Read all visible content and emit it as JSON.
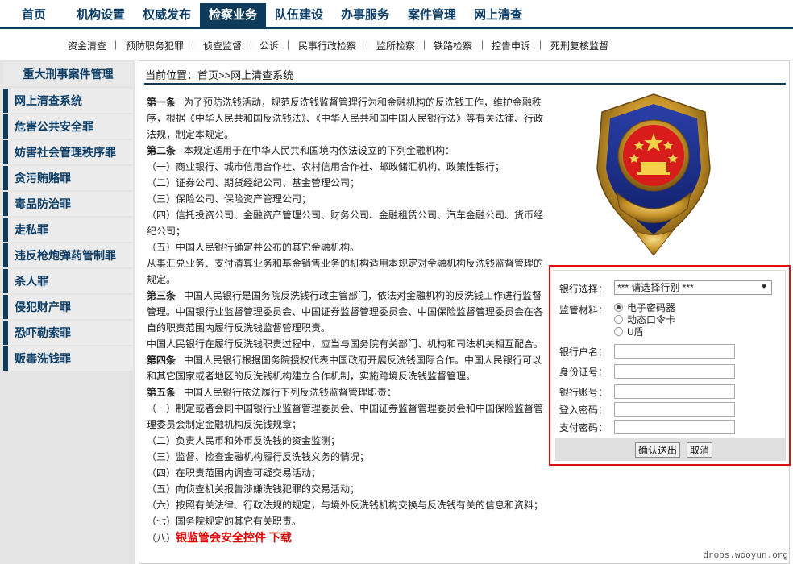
{
  "nav": {
    "items": [
      "首页",
      "机构设置",
      "权威发布",
      "检察业务",
      "队伍建设",
      "办事服务",
      "案件管理",
      "网上清查"
    ],
    "active_index": 3
  },
  "subnav": {
    "items": [
      "资金清查",
      "预防职务犯罪",
      "侦查监督",
      "公诉",
      "民事行政检察",
      "监所检察",
      "铁路检察",
      "控告申诉",
      "死刑复核监督"
    ]
  },
  "sidebar": {
    "title": "重大刑事案件管理",
    "items": [
      "网上清查系统",
      "危害公共安全罪",
      "妨害社会管理秩序罪",
      "贪污贿赂罪",
      "毒品防治罪",
      "走私罪",
      "违反枪炮弹药管制罪",
      "杀人罪",
      "侵犯财产罪",
      "恐吓勒索罪",
      "贩毒洗钱罪"
    ]
  },
  "breadcrumb": "当前位置：首页>>网上清查系统",
  "article": {
    "p1_head": "第一条",
    "p1": "为了预防洗钱活动，规范反洗钱监督管理行为和金融机构的反洗钱工作，维护金融秩序，根据《中华人民共和国反洗钱法》、《中华人民共和国中国人民银行法》等有关法律、行政法规，制定本规定。",
    "p2_head": "第二条",
    "p2": "本规定适用于在中华人民共和国境内依法设立的下列金融机构：",
    "p2_items": [
      "（一）商业银行、城市信用合作社、农村信用合作社、邮政储汇机构、政策性银行；",
      "（二）证券公司、期货经纪公司、基金管理公司；",
      "（三）保险公司、保险资产管理公司；",
      "（四）信托投资公司、金融资产管理公司、财务公司、金融租赁公司、汽车金融公司、货币经纪公司；",
      "（五）中国人民银行确定并公布的其它金融机构。"
    ],
    "p2_tail": "从事汇兑业务、支付清算业务和基金销售业务的机构适用本规定对金融机构反洗钱监督管理的规定。",
    "p3_head": "第三条",
    "p3": "中国人民银行是国务院反洗钱行政主管部门，依法对金融机构的反洗钱工作进行监督管理。中国银行业监督管理委员会、中国证券监督管理委员会、中国保险监督管理委员会在各自的职责范围内履行反洗钱监督管理职责。",
    "p3_tail": "中国人民银行在履行反洗钱职责过程中，应当与国务院有关部门、机构和司法机关相互配合。",
    "p4_head": "第四条",
    "p4": "中国人民银行根据国务院授权代表中国政府开展反洗钱国际合作。中国人民银行可以和其它国家或者地区的反洗钱机构建立合作机制，实施跨境反洗钱监督管理。",
    "p5_head": "第五条",
    "p5": "中国人民银行依法履行下列反洗钱监督管理职责：",
    "p5_items": [
      "（一）制定或者会同中国银行业监督管理委员会、中国证券监督管理委员会和中国保险监督管理委员会制定金融机构反洗钱规章；",
      "（二）负责人民币和外币反洗钱的资金监测；",
      "（三）监督、检查金融机构履行反洗钱义务的情况；",
      "（四）在职责范围内调查可疑交易活动；",
      "（五）向侦查机关报告涉嫌洗钱犯罪的交易活动；",
      "（六）按照有关法律、行政法规的规定，与境外反洗钱机构交换与反洗钱有关的信息和资料；",
      "（七）国务院规定的其它有关职责。"
    ],
    "p5_last_prefix": "（八）",
    "download_link": "银监管会安全控件  下载"
  },
  "form": {
    "bank_label": "银行选择：",
    "bank_selected": "*** 请选择行别 ***",
    "material_label": "监管材料：",
    "options": [
      "电子密码器",
      "动态口令卡",
      "U盾"
    ],
    "selected_option": 0,
    "account_name_label": "银行户名：",
    "id_label": "身份证号：",
    "account_no_label": "银行账号：",
    "login_pw_label": "登入密码：",
    "pay_pw_label": "支付密码：",
    "submit_label": "确认送出",
    "cancel_label": "取消"
  },
  "watermark": "drops.wooyun.org",
  "colors": {
    "nav_blue": "#0e3a5c",
    "alert_red": "#e01010",
    "link_red": "#e00000"
  }
}
